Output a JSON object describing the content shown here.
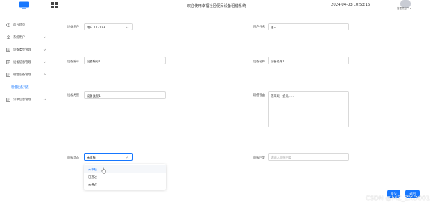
{
  "header": {
    "title": "欢迎使用幸福社区便民设备租借系统",
    "datetime": "2024-04-03 10:53:16",
    "user_label": "管理员账户"
  },
  "sidebar": {
    "items": [
      {
        "label": "后台首页",
        "icon": "clock-icon",
        "expandable": false
      },
      {
        "label": "系统用户",
        "icon": "user-icon",
        "expandable": true
      },
      {
        "label": "设备类型管理",
        "icon": "list-icon",
        "expandable": true
      },
      {
        "label": "设备信息管理",
        "icon": "list-icon",
        "expandable": true
      },
      {
        "label": "租借设备管理",
        "icon": "list-icon",
        "expandable": true
      },
      {
        "label": "租借设备列表",
        "icon": "",
        "expandable": false,
        "active": true
      },
      {
        "label": "订单信息管理",
        "icon": "list-icon",
        "expandable": true
      }
    ]
  },
  "form": {
    "user": {
      "label": "设备用户",
      "value": "用户 123123"
    },
    "user_name": {
      "label": "用户姓名",
      "value": "张三"
    },
    "device_no": {
      "label": "设备编号",
      "value": "设备编号1"
    },
    "device_name": {
      "label": "设备名称",
      "value": "设备名称1"
    },
    "device_type": {
      "label": "设备类型",
      "value": "设备类型1"
    },
    "reason": {
      "label": "租借理由",
      "value": "借来玩一会儿……"
    },
    "status": {
      "label": "审核状态",
      "value": "未审核"
    },
    "reply": {
      "label": "审核回复",
      "placeholder": "请输入审核回复"
    }
  },
  "dropdown": {
    "options": [
      "未审核",
      "已通过",
      "未通过"
    ],
    "selected": "未审核"
  },
  "buttons": {
    "submit": "提交",
    "back": "返回"
  },
  "watermark": "CSDN @MZ_ZXD001",
  "colors": {
    "accent": "#1677ff",
    "sidebar_bg": "#ffffff",
    "page_bg": "#eef1f6"
  }
}
